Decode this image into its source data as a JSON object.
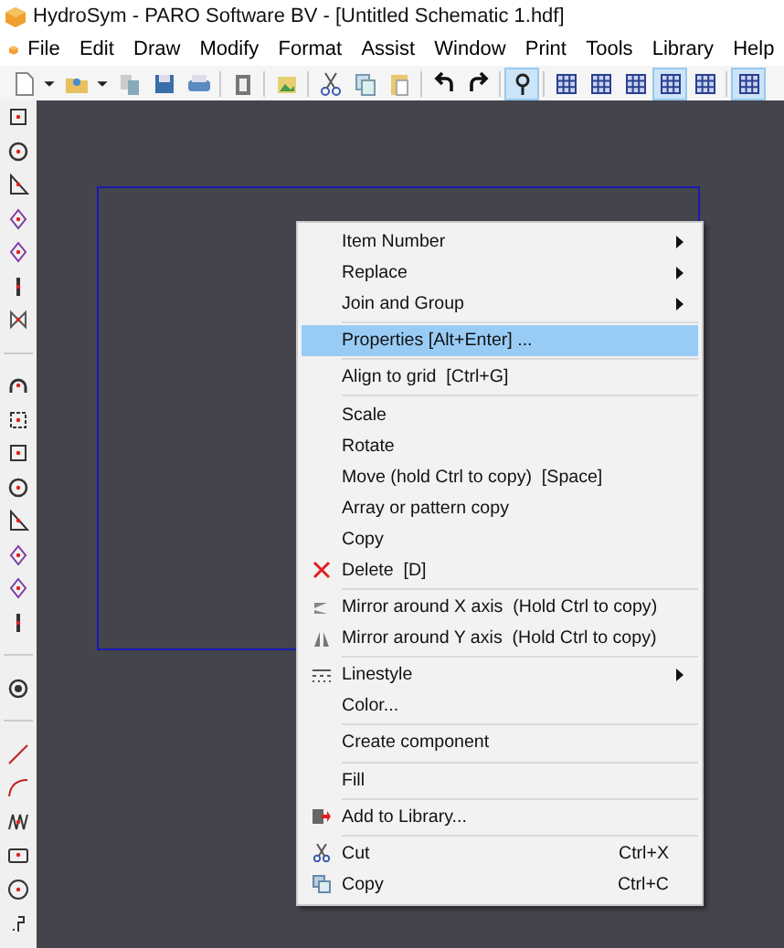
{
  "window": {
    "title": "HydroSym - PARO Software BV - [Untitled Schematic 1.hdf]"
  },
  "menu_bar": [
    "File",
    "Edit",
    "Draw",
    "Modify",
    "Format",
    "Assist",
    "Window",
    "Print",
    "Tools",
    "Library",
    "Help"
  ],
  "toolbar": [
    {
      "selected": false
    },
    {
      "selected": false
    },
    {
      "selected": false
    },
    {
      "selected": false
    },
    {
      "selected": false
    },
    {
      "selected": false
    },
    {
      "selected": false
    },
    {
      "selected": false
    },
    {
      "selected": false
    },
    {
      "selected": false
    },
    {
      "selected": false
    },
    {
      "selected": false
    },
    {
      "selected": false
    },
    {
      "selected": false
    },
    {
      "selected": true
    },
    {
      "selected": false
    },
    {
      "selected": false
    },
    {
      "selected": false
    },
    {
      "selected": true
    },
    {
      "selected": false
    },
    {
      "selected": true
    }
  ],
  "context_menu": {
    "groups": [
      [
        {
          "label": "Item Number",
          "submenu": true,
          "selected": false
        },
        {
          "label": "Replace",
          "submenu": true,
          "selected": false
        },
        {
          "label": "Join and Group",
          "submenu": true,
          "selected": false
        }
      ],
      [
        {
          "label": "Properties [Alt+Enter] ...",
          "submenu": false,
          "selected": true
        }
      ],
      [
        {
          "label": "Align to grid  [Ctrl+G]",
          "submenu": false,
          "selected": false
        }
      ],
      [
        {
          "label": "Scale",
          "submenu": false,
          "selected": false
        },
        {
          "label": "Rotate",
          "submenu": false,
          "selected": false
        },
        {
          "label": "Move (hold Ctrl to copy)  [Space]",
          "submenu": false,
          "selected": false
        },
        {
          "label": "Array or pattern copy",
          "submenu": false,
          "selected": false
        },
        {
          "label": "Copy",
          "submenu": false,
          "selected": false
        },
        {
          "label": "Delete  [D]",
          "submenu": false,
          "selected": false
        }
      ],
      [
        {
          "label": "Mirror around X axis  (Hold Ctrl to copy)",
          "submenu": false,
          "selected": false
        },
        {
          "label": "Mirror around Y axis  (Hold Ctrl to copy)",
          "submenu": false,
          "selected": false
        }
      ],
      [
        {
          "label": "Linestyle",
          "submenu": true,
          "selected": false
        },
        {
          "label": "Color...",
          "submenu": false,
          "selected": false
        }
      ],
      [
        {
          "label": "Create component",
          "submenu": false,
          "selected": false
        }
      ],
      [
        {
          "label": "Fill",
          "submenu": false,
          "selected": false
        }
      ],
      [
        {
          "label": "Add to Library...",
          "submenu": false,
          "selected": false
        }
      ],
      [
        {
          "label": "Cut",
          "shortcut": "Ctrl+X",
          "submenu": false,
          "selected": false
        },
        {
          "label": "Copy",
          "shortcut": "Ctrl+C",
          "submenu": false,
          "selected": false
        }
      ]
    ]
  }
}
